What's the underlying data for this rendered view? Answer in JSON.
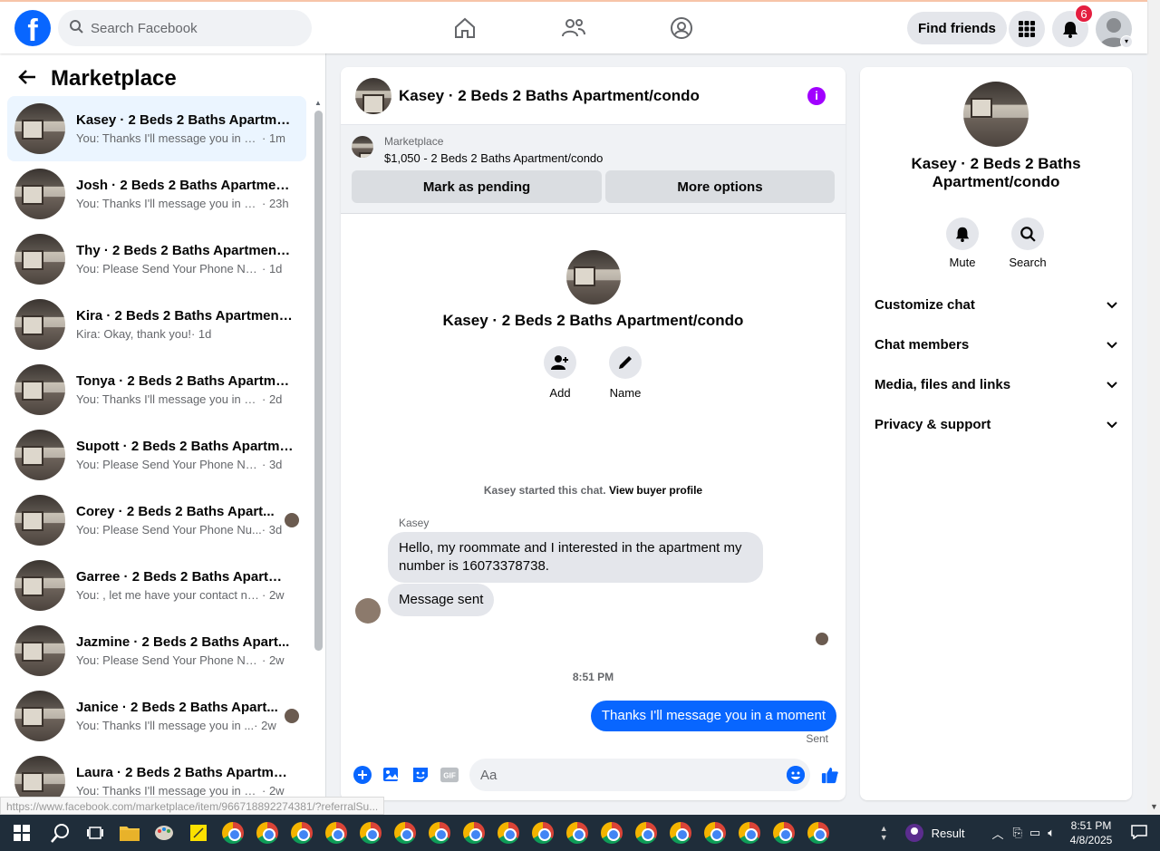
{
  "topbar": {
    "search_placeholder": "Search Facebook",
    "find_friends": "Find friends",
    "notification_count": "6"
  },
  "sidebar": {
    "title": "Marketplace",
    "conversations": [
      {
        "title": "Kasey · 2 Beds 2 Baths Apartme...",
        "message": "You: Thanks I'll message you in a ...",
        "time": " · 1m",
        "active": true
      },
      {
        "title": "Josh · 2 Beds 2 Baths Apartment...",
        "message": "You: Thanks I'll message you in a ...",
        "time": " · 23h"
      },
      {
        "title": "Thy · 2 Beds 2 Baths Apartment/...",
        "message": "You: Please Send Your Phone Num...",
        "time": " · 1d"
      },
      {
        "title": "Kira · 2 Beds 2 Baths Apartment...",
        "message": "Kira: Okay, thank you!",
        "time": " · 1d"
      },
      {
        "title": "Tonya · 2 Beds 2 Baths Apartme...",
        "message": "You: Thanks I'll message you in a m...",
        "time": " · 2d"
      },
      {
        "title": "Supott · 2 Beds 2 Baths Apartme...",
        "message": "You: Please Send Your Phone Num...",
        "time": " · 3d"
      },
      {
        "title": "Corey · 2 Beds 2 Baths Apart...",
        "message": "You: Please Send Your Phone Nu...",
        "time": " · 3d"
      },
      {
        "title": "Garree · 2 Beds 2 Baths Apartme...",
        "message": "You: , let me have your contact nu...",
        "time": " · 2w"
      },
      {
        "title": "Jazmine · 2 Beds 2 Baths Apart...",
        "message": "You: Please Send Your Phone Num...",
        "time": " · 2w"
      },
      {
        "title": "Janice · 2 Beds 2 Baths Apart...",
        "message": "You: Thanks I'll message you in ...",
        "time": " · 2w"
      },
      {
        "title": "Laura · 2 Beds 2 Baths Apartmen...",
        "message": "You: Thanks I'll message you in a ...",
        "time": " · 2w"
      }
    ]
  },
  "chat": {
    "title": "Kasey · 2 Beds 2 Baths Apartment/condo",
    "marketplace_label": "Marketplace",
    "listing": "$1,050 - 2 Beds 2 Baths Apartment/condo",
    "mark_pending": "Mark as pending",
    "more_options": "More options",
    "intro_name": "Kasey · 2 Beds 2 Baths Apartment/condo",
    "add_label": "Add",
    "name_label": "Name",
    "started_text": "Kasey started this chat.",
    "view_profile": "View buyer profile",
    "sender": "Kasey",
    "incoming_1": "Hello, my roommate and I interested in the apartment my number is 16073378738.",
    "incoming_2": "Message sent",
    "timestamp": "8:51 PM",
    "outgoing": "Thanks I'll message you in a moment",
    "sent_label": "Sent",
    "composer_placeholder": "Aa"
  },
  "info_panel": {
    "name": "Kasey · 2 Beds 2 Baths Apartment/condo",
    "mute": "Mute",
    "search": "Search",
    "sections": [
      "Customize chat",
      "Chat members",
      "Media, files and links",
      "Privacy & support"
    ]
  },
  "status_url": "https://www.facebook.com/marketplace/item/966718892274381/?referralSu...",
  "taskbar": {
    "app_label": "Result",
    "time": "8:51 PM",
    "date": "4/8/2025"
  },
  "colors": {
    "accent": "#0866ff",
    "info_icon": "#a100ff",
    "badge": "#e41e3f"
  }
}
